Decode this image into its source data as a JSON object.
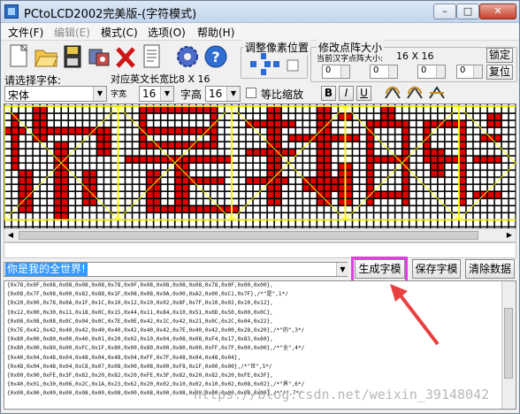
{
  "window": {
    "title": "PCtoLCD2002完美版-(字符模式)"
  },
  "menu": [
    {
      "label": "文件(F)",
      "disabled": false
    },
    {
      "label": "编辑(E)",
      "disabled": true
    },
    {
      "label": "模式(C)",
      "disabled": false
    },
    {
      "label": "选项(O)",
      "disabled": false
    },
    {
      "label": "帮助(H)",
      "disabled": false
    }
  ],
  "toolbar": {
    "icons": [
      "new-icon",
      "open-icon",
      "save-icon",
      "tool-icon",
      "delete-icon",
      "document-icon",
      "settings-icon",
      "help-icon"
    ]
  },
  "pixel_adjust": {
    "label": "调整像素位置"
  },
  "dot_size": {
    "label": "修改点阵大小",
    "current_label": "当前汉字点阵大小:",
    "current_value": "16 X 16",
    "lock_button": "锁定",
    "restore_button": "复位",
    "spinners": [
      "0",
      "0",
      "0",
      "0"
    ]
  },
  "font": {
    "select_label": "请选择字体:",
    "font_value": "宋体",
    "ascii_info": "对应英文长宽比8 X 16",
    "width_label": "字宽",
    "width_value": "16",
    "height_label": "字高",
    "height_value": "16",
    "proportional_label": "等比缩放",
    "bold": "B",
    "italic": "I",
    "underline": "U"
  },
  "input": {
    "text": "你是我的全世界!"
  },
  "buttons": {
    "generate": "生成字模",
    "save": "保存字模",
    "clear": "清除数据"
  },
  "output_lines": [
    "{0x78,0x0F,0x08,0x08,0x08,0x08,0x78,0x0F,0x08,0x08,0x08,0x08,0x78,0x0F,0x00,0x00},",
    "{0x08,0x7F,0x08,0x00,0x82,0x88,0x1F,0x08,0x08,0x9A,0x00,0xA2,0x00,0xC1,0x7F},/*\"是\",1*/",
    "{0x20,0x00,0x78,0x0A,0x1F,0x1C,0x10,0x12,0x10,0x02,0x8F,0x7F,0x10,0x02,0x10,0x12},",
    "{0x12,0x00,0x30,0x11,0x18,0x0C,0x15,0x44,0x11,0x84,0x10,0x51,0x0D,0x50,0x00,0x0C},",
    "{0x08,0x08,0x08,0x0C,0x04,0x0C,0x7E,0x0E,0x42,0x1C,0x42,0x21,0x0C,0x2C,0x04,0x22},",
    "{0x7E,0x42,0x42,0x40,0x42,0x40,0x40,0x42,0x40,0x42,0x7E,0x40,0x42,0x00,0x28,0x20},/*\"的\",3*/",
    "{0x80,0x00,0x80,0x00,0x40,0x01,0x20,0x02,0x10,0x04,0x08,0x08,0xF4,0x17,0x83,0x60},",
    "{0x80,0x00,0x80,0x00,0xFC,0x1F,0x80,0x00,0x80,0x00,0x80,0x00,0xFF,0x7F,0x00,0x00},/*\"全\",4*/",
    "{0x40,0x04,0x48,0x04,0x48,0x04,0x48,0x04,0xFF,0x7F,0x48,0x04,0x48,0x04},",
    "{0x48,0x04,0x48,0x04,0xC8,0x07,0x08,0x00,0x08,0x00,0xF8,0x1F,0x00,0x00},/*\"世\",5*/",
    "{0x00,0x00,0xFE,0x3F,0x82,0x20,0x82,0x20,0xFE,0x3F,0x82,0x20,0x82,0x20,0xFE,0x3F},",
    "{0x40,0x01,0x30,0x06,0x2C,0x1A,0x23,0x62,0x20,0x02,0x10,0x02,0x10,0x02,0x08,0x02},/*\"界\",6*/",
    "{0x00,0x00,0x00,0x00,0x08,0x00,0x08,0x00,0x08,0x00,0x08,0x00,0x00,0x00,0x08,0x00},/*\"!\",7*/"
  ],
  "watermark": "https://blog.csdn.net/weixin_39148042",
  "colors": {
    "pixel_on": "#e00000",
    "grid_line": "#000000",
    "char_border": "#ffff00",
    "highlight": "#e040e0",
    "arrow": "#e84040"
  }
}
